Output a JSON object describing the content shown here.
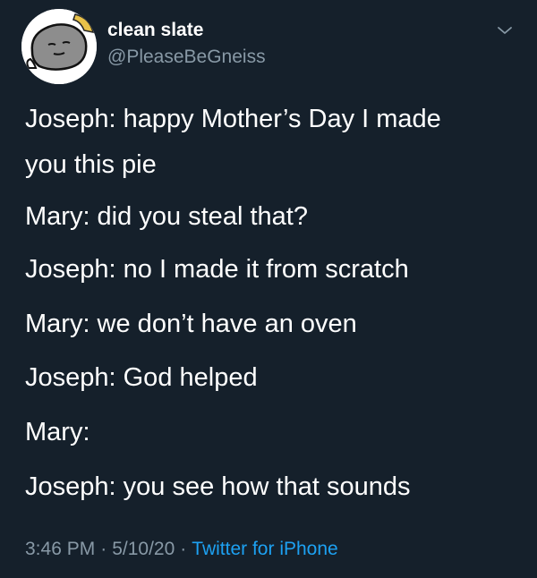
{
  "user": {
    "display_name": "clean slate",
    "handle": "@PleaseBeGneiss",
    "avatar_icon": "drawn-rock-face-avatar",
    "menu_icon": "chevron-down-icon"
  },
  "tweet": {
    "lines": [
      "Joseph: happy Mother’s Day I made",
      "you this pie",
      "Mary: did you steal that?",
      "Joseph: no I made it from scratch",
      "Mary: we don’t have an oven",
      "Joseph: God helped",
      "Mary:",
      "Joseph: you see how that sounds"
    ]
  },
  "meta": {
    "time": "3:46 PM",
    "date": "5/10/20",
    "separator": "·",
    "source": "Twitter for iPhone"
  },
  "colors": {
    "background": "#15202b",
    "primary_text": "#ffffff",
    "secondary_text": "#8899a6",
    "link": "#1da1f2"
  }
}
